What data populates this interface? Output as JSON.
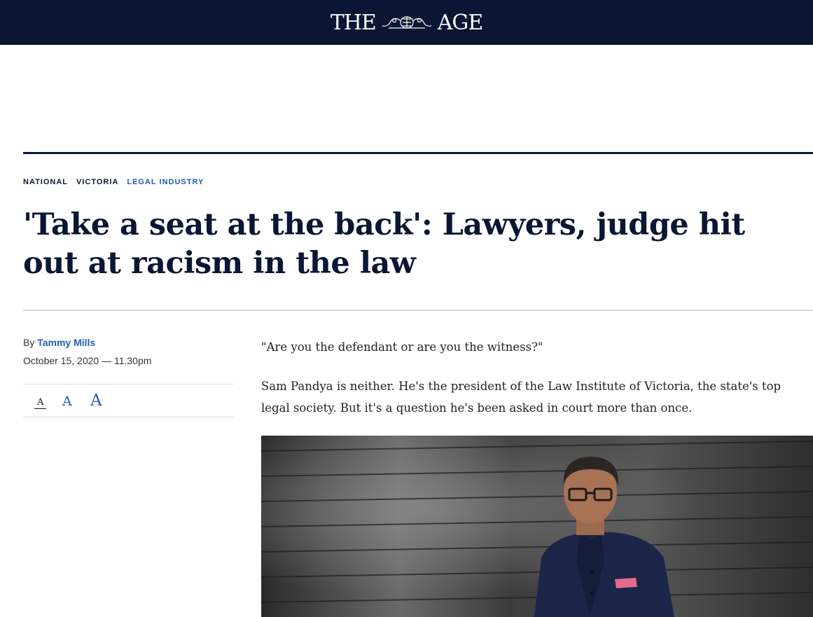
{
  "masthead": {
    "title_left": "THE",
    "title_right": "AGE",
    "crest_icon": "coat-of-arms-icon",
    "background": "#0a1633"
  },
  "breadcrumb": {
    "items": [
      "NATIONAL",
      "VICTORIA",
      "LEGAL INDUSTRY"
    ],
    "accent": "#1e5fb4"
  },
  "article": {
    "headline": "'Take a seat at the back': Lawyers, judge hit out at racism in the law",
    "byline_prefix": "By",
    "author": "Tammy Mills",
    "date": "October 15, 2020 — 11.30pm",
    "text_size": {
      "small": "A",
      "medium": "A",
      "large": "A"
    },
    "paragraphs": [
      "\"Are you the defendant or are you the witness?\"",
      "Sam Pandya is neither. He's the president of the Law Institute of Victoria, the state's top legal society. But it's a question he's been asked in court more than once."
    ]
  }
}
